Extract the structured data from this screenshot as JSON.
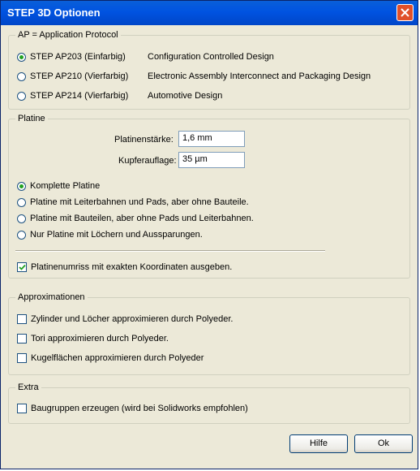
{
  "window": {
    "title": "STEP 3D Optionen"
  },
  "ap_group": {
    "legend": "AP = Application Protocol",
    "options": [
      {
        "label": "STEP AP203 (Einfarbig)",
        "desc": "Configuration Controlled Design",
        "selected": true
      },
      {
        "label": "STEP AP210 (Vierfarbig)",
        "desc": "Electronic Assembly Interconnect and Packaging Design",
        "selected": false
      },
      {
        "label": "STEP AP214 (Vierfarbig)",
        "desc": "Automotive Design",
        "selected": false
      }
    ]
  },
  "platine_group": {
    "legend": "Platine",
    "thickness_label": "Platinenstärke:",
    "thickness_value": "1,6 mm",
    "copper_label": "Kupferauflage:",
    "copper_value": "35 µm",
    "options": [
      {
        "label": "Komplette Platine",
        "selected": true
      },
      {
        "label": "Platine mit Leiterbahnen und Pads, aber ohne Bauteile.",
        "selected": false
      },
      {
        "label": "Platine mit Bauteilen, aber ohne Pads und Leiterbahnen.",
        "selected": false
      },
      {
        "label": "Nur Platine mit Löchern und Aussparungen.",
        "selected": false
      }
    ],
    "outline_check": {
      "label": "Platinenumriss mit exakten Koordinaten ausgeben.",
      "checked": true
    }
  },
  "approx_group": {
    "legend": "Approximationen",
    "checks": [
      {
        "label": "Zylinder und Löcher approximieren durch Polyeder.",
        "checked": false
      },
      {
        "label": "Tori approximieren durch Polyeder.",
        "checked": false
      },
      {
        "label": "Kugelflächen approximieren durch Polyeder",
        "checked": false
      }
    ]
  },
  "extra_group": {
    "legend": "Extra",
    "check": {
      "label": "Baugruppen erzeugen (wird bei Solidworks empfohlen)",
      "checked": false
    }
  },
  "buttons": {
    "help": "Hilfe",
    "ok": "Ok"
  }
}
